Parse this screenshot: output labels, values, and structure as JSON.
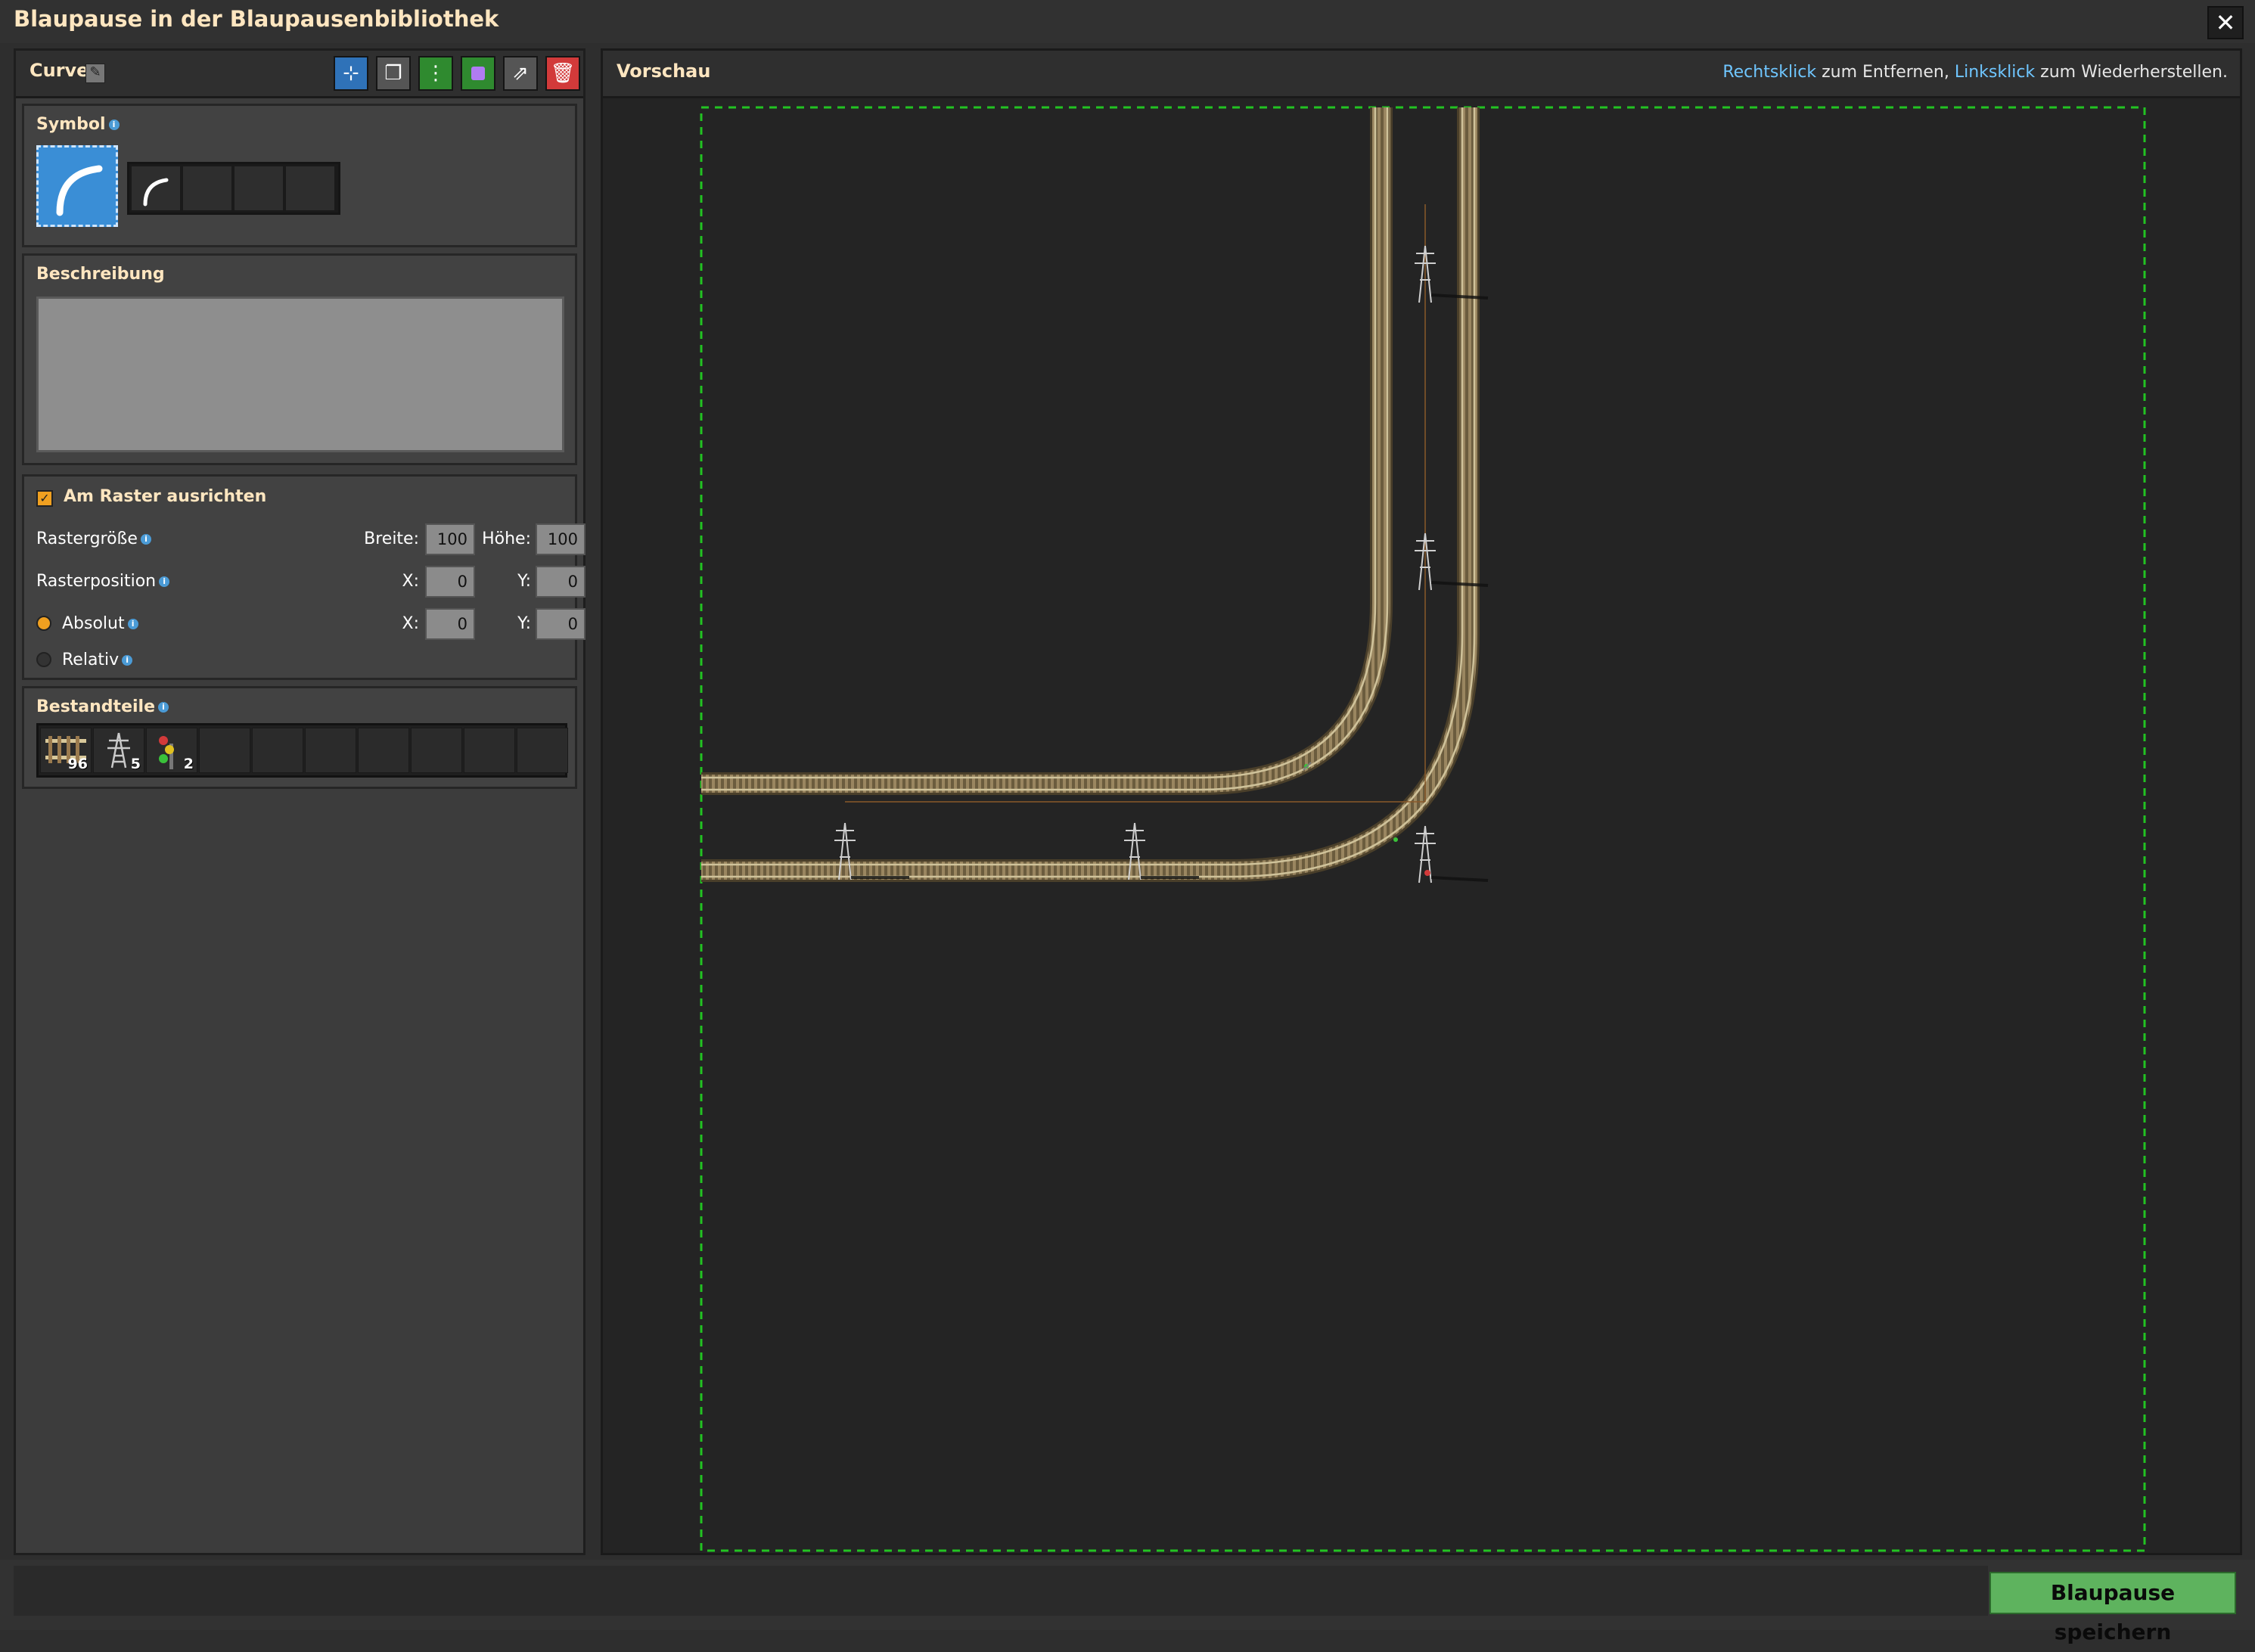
{
  "window": {
    "title": "Blaupause in der Blaupausenbibliothek",
    "close_symbol": "✕"
  },
  "left": {
    "blueprint_name": "Curve",
    "edit_icon": "pencil-icon",
    "toolbar": [
      {
        "icon": "select-area-icon",
        "color": "#2f72b8"
      },
      {
        "icon": "copy-icon",
        "color": "#555555"
      },
      {
        "icon": "grid-icon",
        "color": "#2f8a2f"
      },
      {
        "icon": "purple-square-icon",
        "color": "#2f8a2f"
      },
      {
        "icon": "export-icon",
        "color": "#555555"
      },
      {
        "icon": "trash-icon",
        "color": "#d23a3a"
      }
    ],
    "symbol": {
      "title": "Symbol",
      "icon": "curved-rail-icon"
    },
    "description": {
      "title": "Beschreibung",
      "value": ""
    },
    "grid": {
      "snap_label": "Am Raster ausrichten",
      "snap_checked": true,
      "size_label": "Rastergröße",
      "width_label": "Breite:",
      "width_value": "100",
      "height_label": "Höhe:",
      "height_value": "100",
      "position_label": "Rasterposition",
      "pos_x_label": "X:",
      "pos_x_value": "0",
      "pos_y_label": "Y:",
      "pos_y_value": "0",
      "absolute_label": "Absolut",
      "abs_x_label": "X:",
      "abs_x_value": "0",
      "abs_y_label": "Y:",
      "abs_y_value": "0",
      "relative_label": "Relativ",
      "selected_mode": "Absolut"
    },
    "components": {
      "title": "Bestandteile",
      "items": [
        {
          "icon": "rail-icon",
          "count": "96"
        },
        {
          "icon": "big-electric-pole-icon",
          "count": "5"
        },
        {
          "icon": "rail-signal-icon",
          "count": "2"
        }
      ]
    }
  },
  "preview": {
    "title": "Vorschau",
    "hint_rightclick": "Rechtsklick",
    "hint_middle": " zum Entfernen, ",
    "hint_leftclick": "Linksklick",
    "hint_end": " zum Wiederherstellen."
  },
  "footer": {
    "save_label": "Blaupause speichern"
  },
  "colors": {
    "accent_title": "#ffe6c0",
    "link": "#6fc6ff",
    "save_green": "#5eb35e",
    "grid_dash": "#22c322",
    "rail": "#8a7a58"
  }
}
